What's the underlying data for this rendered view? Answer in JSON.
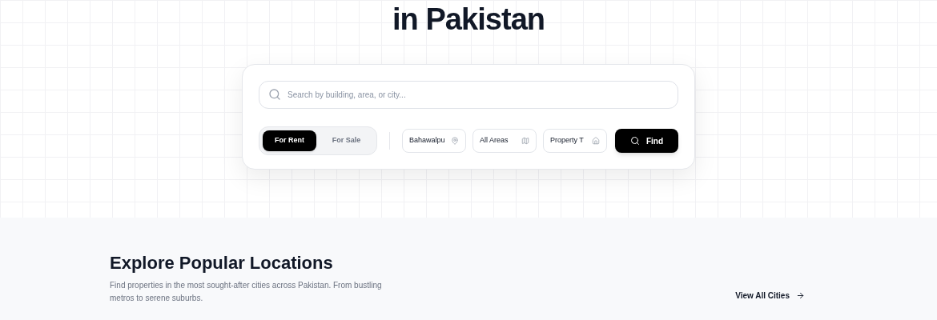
{
  "hero": {
    "title_line": "in Pakistan"
  },
  "search": {
    "placeholder": "Search by building, area, or city..."
  },
  "listing_toggle": [
    {
      "label": "For Rent",
      "selected": true
    },
    {
      "label": "For Sale",
      "selected": false
    }
  ],
  "filters": [
    {
      "kind": "city",
      "value": "Bahawalpu"
    },
    {
      "kind": "area",
      "value": "All Areas"
    },
    {
      "kind": "type",
      "value": "Property T"
    }
  ],
  "find_button": "Find",
  "locations": {
    "title": "Explore Popular Locations",
    "description": "Find properties in the most sought-after cities across Pakistan. From bustling metros to serene suburbs.",
    "link": "View All Cities"
  }
}
